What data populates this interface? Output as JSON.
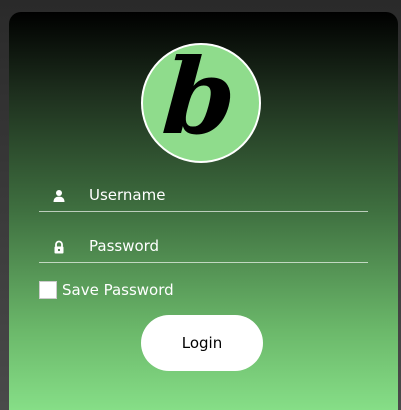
{
  "logo": {
    "letter": "b",
    "background": "#8fdc8c"
  },
  "username": {
    "placeholder": "Username",
    "icon": "user-icon"
  },
  "password": {
    "placeholder": "Password",
    "icon": "lock-icon"
  },
  "save_password": {
    "label": "Save Password",
    "checked": false
  },
  "login": {
    "label": "Login"
  },
  "colors": {
    "accent": "#86de87",
    "card_top": "#000000",
    "text": "#ffffff"
  }
}
